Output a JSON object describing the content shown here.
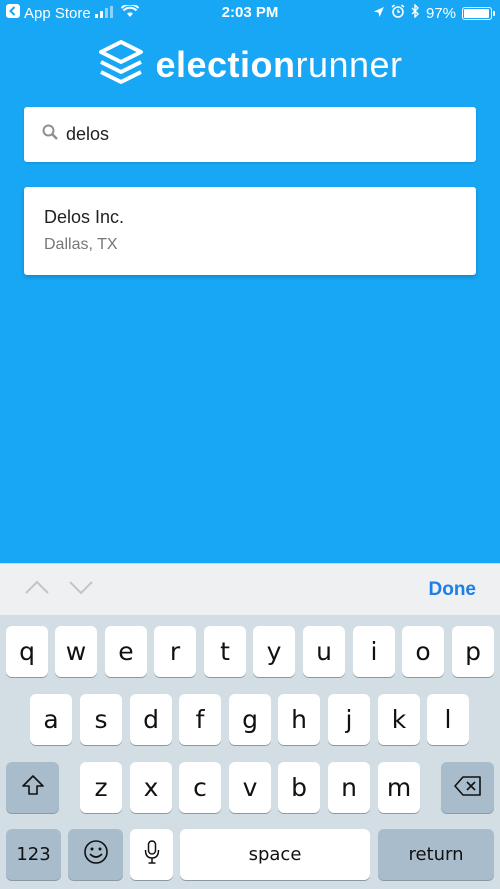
{
  "status_bar": {
    "back_app": "App Store",
    "time": "2:03 PM",
    "battery": "97%",
    "battery_level": 0.97
  },
  "header": {
    "logo_bold": "election",
    "logo_light": "runner",
    "logo_icon": "stack-layers-icon"
  },
  "search": {
    "value": "delos",
    "placeholder": ""
  },
  "results": [
    {
      "name": "Delos Inc.",
      "location": "Dallas, TX"
    }
  ],
  "accessory": {
    "done_label": "Done"
  },
  "keyboard": {
    "row1": [
      "q",
      "w",
      "e",
      "r",
      "t",
      "y",
      "u",
      "i",
      "o",
      "p"
    ],
    "row2": [
      "a",
      "s",
      "d",
      "f",
      "g",
      "h",
      "j",
      "k",
      "l"
    ],
    "row3": [
      "z",
      "x",
      "c",
      "v",
      "b",
      "n",
      "m"
    ],
    "numbers_label": "123",
    "space_label": "space",
    "return_label": "return"
  },
  "colors": {
    "background": "#17a7f5",
    "done": "#1f7de6",
    "caret": "#2a7bf6"
  }
}
